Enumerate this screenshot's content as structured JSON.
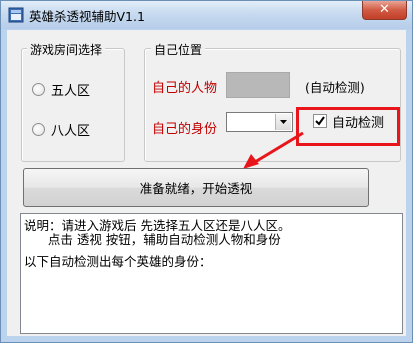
{
  "window": {
    "title": "英雄杀透视辅助V1.1",
    "close_glyph": "✕"
  },
  "room_group": {
    "legend": "游戏房间选择",
    "options": [
      "五人区",
      "八人区"
    ],
    "selected": null
  },
  "position_group": {
    "legend": "自己位置",
    "character_label": "自己的人物",
    "character_value": "",
    "auto_detect_note": "(自动检测)",
    "identity_label": "自己的身份",
    "identity_value": "",
    "auto_detect_checkbox_label": "自动检测",
    "auto_detect_checked": true
  },
  "start_button": {
    "label": "准备就绪，开始透视"
  },
  "instructions": {
    "lines": [
      "说明：请进入游戏后 先选择五人区还是八人区。",
      "      点击 透视 按钮，辅助自动检测人物和身份",
      "",
      "以下自动检测出每个英雄的身份："
    ]
  },
  "annotations": {
    "highlight_color": "#e8151b"
  }
}
